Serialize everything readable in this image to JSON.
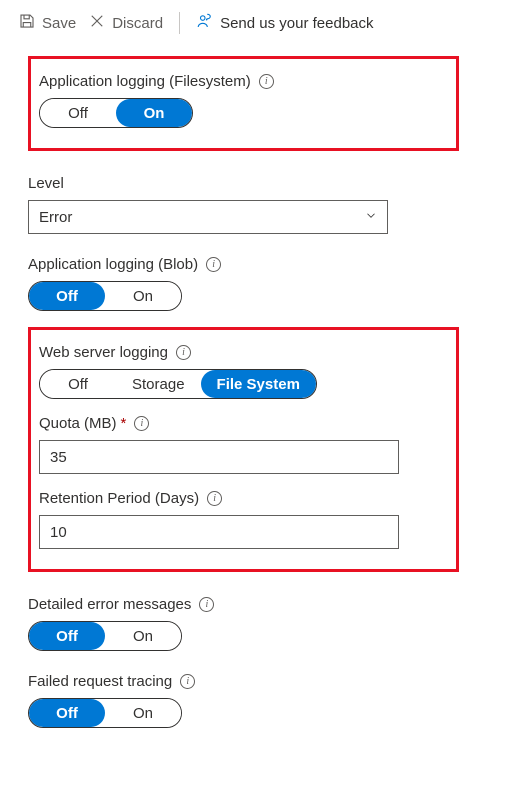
{
  "toolbar": {
    "save_label": "Save",
    "discard_label": "Discard",
    "feedback_label": "Send us your feedback"
  },
  "app_log_fs": {
    "label": "Application logging (Filesystem)",
    "options": {
      "off": "Off",
      "on": "On"
    },
    "selected": "on"
  },
  "level": {
    "label": "Level",
    "value": "Error"
  },
  "app_log_blob": {
    "label": "Application logging (Blob)",
    "options": {
      "off": "Off",
      "on": "On"
    },
    "selected": "off"
  },
  "web_server_logging": {
    "label": "Web server logging",
    "options": {
      "off": "Off",
      "storage": "Storage",
      "fs": "File System"
    },
    "selected": "fs"
  },
  "quota": {
    "label": "Quota (MB)",
    "value": "35"
  },
  "retention": {
    "label": "Retention Period (Days)",
    "value": "10"
  },
  "detailed_errors": {
    "label": "Detailed error messages",
    "options": {
      "off": "Off",
      "on": "On"
    },
    "selected": "off"
  },
  "failed_request_tracing": {
    "label": "Failed request tracing",
    "options": {
      "off": "Off",
      "on": "On"
    },
    "selected": "off"
  }
}
